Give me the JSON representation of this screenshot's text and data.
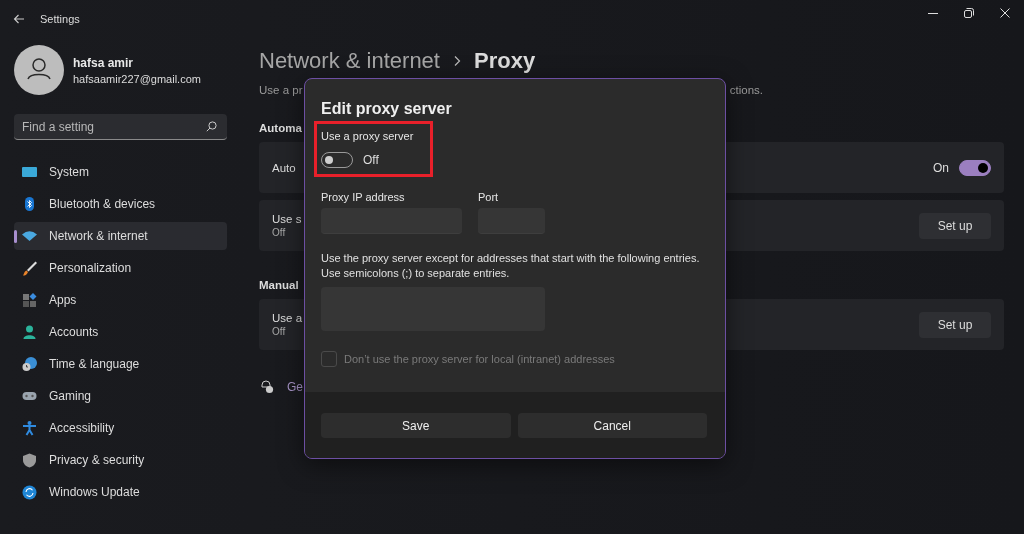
{
  "window": {
    "title": "Settings"
  },
  "account": {
    "name": "hafsa amir",
    "email": "hafsaamir227@gmail.com"
  },
  "search": {
    "placeholder": "Find a setting"
  },
  "sidebar": {
    "items": [
      {
        "label": "System",
        "selected": false
      },
      {
        "label": "Bluetooth & devices",
        "selected": false
      },
      {
        "label": "Network & internet",
        "selected": true
      },
      {
        "label": "Personalization",
        "selected": false
      },
      {
        "label": "Apps",
        "selected": false
      },
      {
        "label": "Accounts",
        "selected": false
      },
      {
        "label": "Time & language",
        "selected": false
      },
      {
        "label": "Gaming",
        "selected": false
      },
      {
        "label": "Accessibility",
        "selected": false
      },
      {
        "label": "Privacy & security",
        "selected": false
      },
      {
        "label": "Windows Update",
        "selected": false
      }
    ]
  },
  "page": {
    "breadcrumb": [
      "Network & internet",
      "Proxy"
    ],
    "description": {
      "start": "Use a pr",
      "end": "ctions."
    },
    "sections": [
      {
        "heading": "Automa",
        "cards": [
          {
            "kind": "toggle",
            "title": "Auto",
            "state_label": "On",
            "on": true
          },
          {
            "kind": "button",
            "title": "Use s",
            "subtitle": "Off",
            "button": "Set up"
          }
        ]
      },
      {
        "heading": "Manual",
        "cards": [
          {
            "kind": "button",
            "title": "Use a",
            "subtitle": "Off",
            "button": "Set up"
          }
        ]
      }
    ],
    "help_link": {
      "label": "Ge"
    }
  },
  "dialog": {
    "title": "Edit proxy server",
    "toggle": {
      "label": "Use a proxy server",
      "on": false,
      "state_label": "Off",
      "highlighted": true
    },
    "ip_field": {
      "label": "Proxy IP address"
    },
    "port_field": {
      "label": "Port"
    },
    "exceptions": {
      "lines": [
        "Use the proxy server except for addresses that start with the following entries.",
        "Use semicolons (;) to separate entries."
      ]
    },
    "local_checkbox": {
      "label": "Don’t use the proxy server for local (intranet) addresses",
      "checked": false,
      "disabled": true
    },
    "buttons": [
      {
        "label": "Save"
      },
      {
        "label": "Cancel"
      }
    ]
  }
}
